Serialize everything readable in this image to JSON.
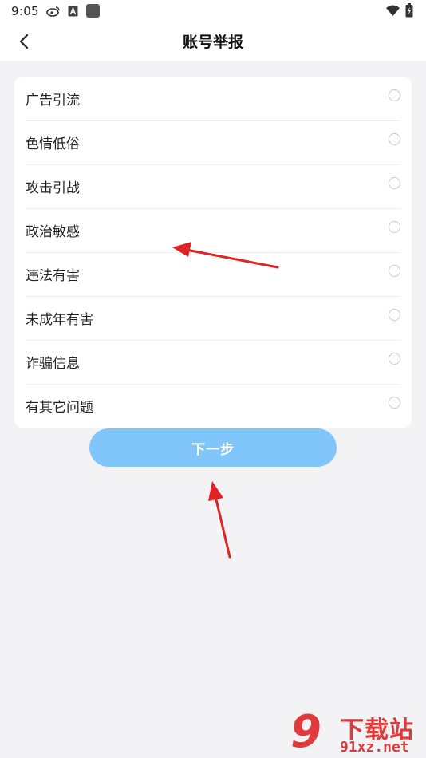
{
  "status_bar": {
    "time": "9:05"
  },
  "header": {
    "title": "账号举报",
    "back_icon": "chevron-left-icon"
  },
  "options": [
    {
      "label": "广告引流"
    },
    {
      "label": "色情低俗"
    },
    {
      "label": "攻击引战"
    },
    {
      "label": "政治敏感"
    },
    {
      "label": "违法有害"
    },
    {
      "label": "未成年有害"
    },
    {
      "label": "诈骗信息"
    },
    {
      "label": "有其它问题"
    }
  ],
  "next_button": {
    "label": "下一步"
  },
  "watermark": {
    "title": "下载站",
    "url": "91xz.net"
  },
  "colors": {
    "accent": "#80c6fb",
    "annotation_arrow": "#e02424",
    "background": "#f3f3f6"
  }
}
